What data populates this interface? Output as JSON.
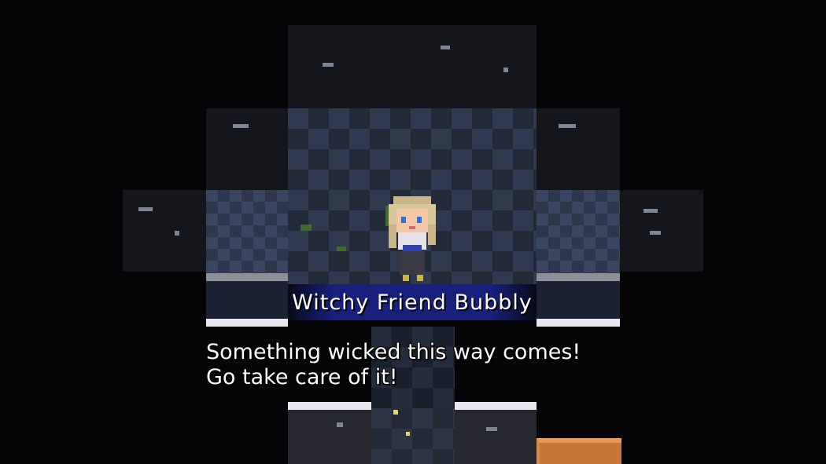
{
  "dialogue": {
    "speaker_name": "Witchy Friend Bubbly",
    "lines": [
      "Something wicked this way comes!",
      "Go take care of it!"
    ]
  },
  "sprites": {
    "character": "witch-girl-sprite",
    "crate": "wooden-crate-sprite"
  },
  "colors": {
    "name_plate": "#17207a",
    "text": "#ffffff",
    "floor": "#2f3a4e",
    "crate": "#c9763a"
  }
}
